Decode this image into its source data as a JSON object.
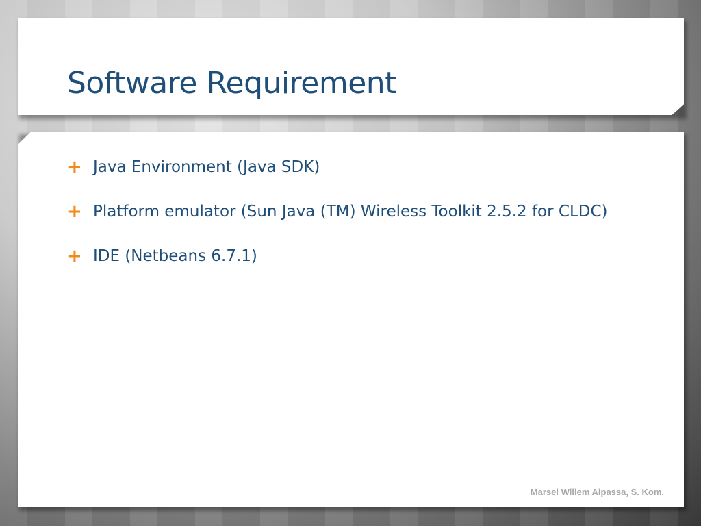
{
  "slide": {
    "title": "Software Requirement",
    "bullets": [
      {
        "icon": "plus-icon",
        "text": "Java Environment (Java SDK)"
      },
      {
        "icon": "plus-icon",
        "text": "Platform emulator (Sun Java (TM) Wireless Toolkit 2.5.2 for CLDC)"
      },
      {
        "icon": "plus-icon",
        "text": "IDE (Netbeans 6.7.1)"
      }
    ],
    "footer": "Marsel Willem Aipassa, S. Kom.",
    "bullet_glyph": "+"
  },
  "colors": {
    "title": "#1f4e79",
    "text": "#1f4e79",
    "bullet": "#f08a1c",
    "footer": "#a8a8a8"
  }
}
